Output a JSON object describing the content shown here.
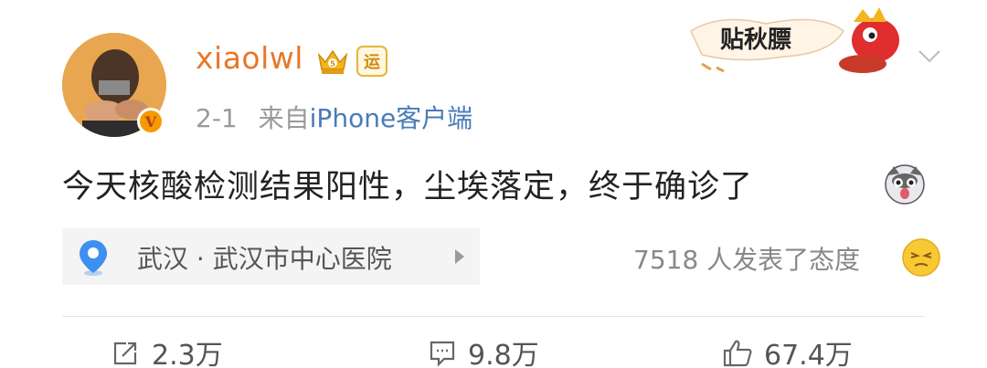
{
  "post": {
    "username": "xiaolwl",
    "badge_yun": "运",
    "avatar_badge": "V",
    "time": "2-1",
    "source_prefix": "来自",
    "source": "iPhone客户端",
    "content": "今天核酸检测结果阳性，尘埃落定，终于确诊了",
    "sticker_text": "贴秋膘"
  },
  "location": {
    "text": "武汉 · 武汉市中心医院"
  },
  "reactions": {
    "text": "7518 人发表了态度"
  },
  "actions": {
    "repost": "2.3万",
    "comment": "9.8万",
    "like": "67.4万"
  },
  "colors": {
    "username": "#e8772a",
    "source_link": "#4a7bb7",
    "pin": "#3d8ff0"
  },
  "icons": [
    "vip-crown-icon",
    "yun-badge-icon",
    "collapse-chevron-icon",
    "location-pin-icon",
    "arrow-right-icon",
    "dog-emoji-icon",
    "face-emoji-icon",
    "repost-icon",
    "comment-icon",
    "like-icon"
  ]
}
